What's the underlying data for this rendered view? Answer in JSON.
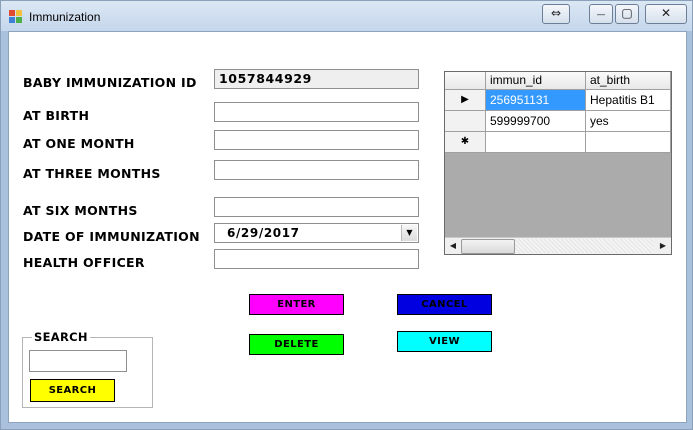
{
  "window": {
    "title": "Immunization",
    "icon": "form-icon",
    "buttons": {
      "resize": "⇔",
      "minimize": "—",
      "maximize": "▢",
      "close": "✕"
    }
  },
  "form": {
    "labels": {
      "baby_id": "BABY IMMUNIZATION ID",
      "at_birth": "AT BIRTH",
      "one_month": "AT ONE MONTH",
      "three_months": "AT THREE MONTHS",
      "six_months": "AT SIX MONTHS",
      "date": "DATE OF IMMUNIZATION",
      "officer": "HEALTH OFFICER"
    },
    "values": {
      "baby_id": "1057844929",
      "at_birth": "",
      "one_month": "",
      "three_months": "",
      "six_months": "",
      "date": "6/29/2017",
      "officer": ""
    }
  },
  "buttons": {
    "enter": "ENTER",
    "cancel": "CANCEL",
    "delete": "DELETE",
    "view": "VIEW",
    "search": "SEARCH"
  },
  "search": {
    "group_title": "SEARCH",
    "value": ""
  },
  "grid": {
    "columns": [
      "immun_id",
      "at_birth"
    ],
    "rows": [
      {
        "marker": "▶",
        "immun_id": "256951131",
        "at_birth": "Hepatitis B1",
        "selected": true
      },
      {
        "marker": "",
        "immun_id": "599999700",
        "at_birth": "yes",
        "selected": false
      }
    ],
    "new_row_marker": "✱",
    "scroll_left": "◀",
    "scroll_right": "▶"
  },
  "colors": {
    "enter": "#ff00ff",
    "cancel": "#0000e0",
    "delete": "#00ff00",
    "view": "#00ffff",
    "search": "#ffff00",
    "grid_selection": "#3399ff",
    "grid_background": "#ababab"
  }
}
